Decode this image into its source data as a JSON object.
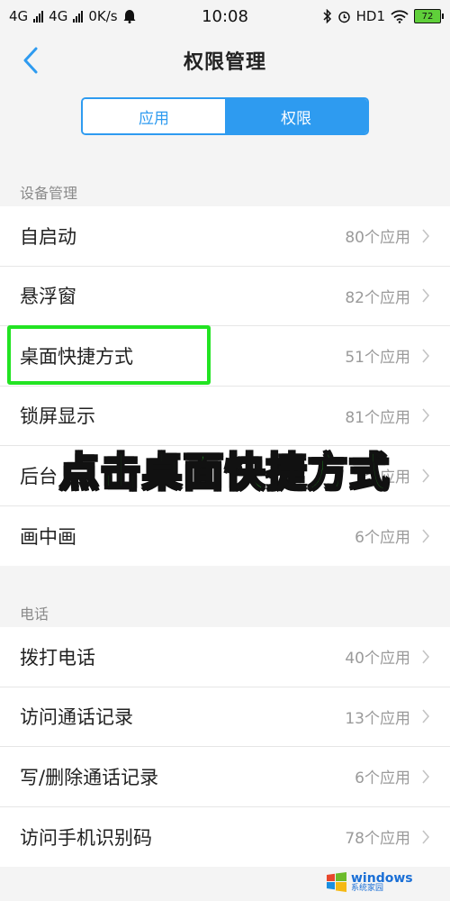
{
  "status_bar": {
    "left": [
      "4G",
      "4G",
      "0K/s"
    ],
    "time": "10:08",
    "right_label": "HD1",
    "battery": "72"
  },
  "header": {
    "title": "权限管理"
  },
  "segment": {
    "tabs": [
      "应用",
      "权限"
    ],
    "active": 1
  },
  "sections": [
    {
      "label": "设备管理",
      "items": [
        {
          "label": "自启动",
          "count": "80个应用"
        },
        {
          "label": "悬浮窗",
          "count": "82个应用"
        },
        {
          "label": "桌面快捷方式",
          "count": "51个应用"
        },
        {
          "label": "锁屏显示",
          "count": "81个应用"
        },
        {
          "label": "后台",
          "count": "个应用"
        },
        {
          "label": "画中画",
          "count": "6个应用"
        }
      ]
    },
    {
      "label": "电话",
      "items": [
        {
          "label": "拨打电话",
          "count": "40个应用"
        },
        {
          "label": "访问通话记录",
          "count": "13个应用"
        },
        {
          "label": "写/删除通话记录",
          "count": "6个应用"
        },
        {
          "label": "访问手机识别码",
          "count": "78个应用"
        }
      ]
    }
  ],
  "overlay": {
    "text": "点击桌面快捷方式"
  },
  "watermark": {
    "main": "windows",
    "sub": "系统家园"
  },
  "colors": {
    "accent": "#2e9bf0",
    "highlight": "#22e322"
  }
}
